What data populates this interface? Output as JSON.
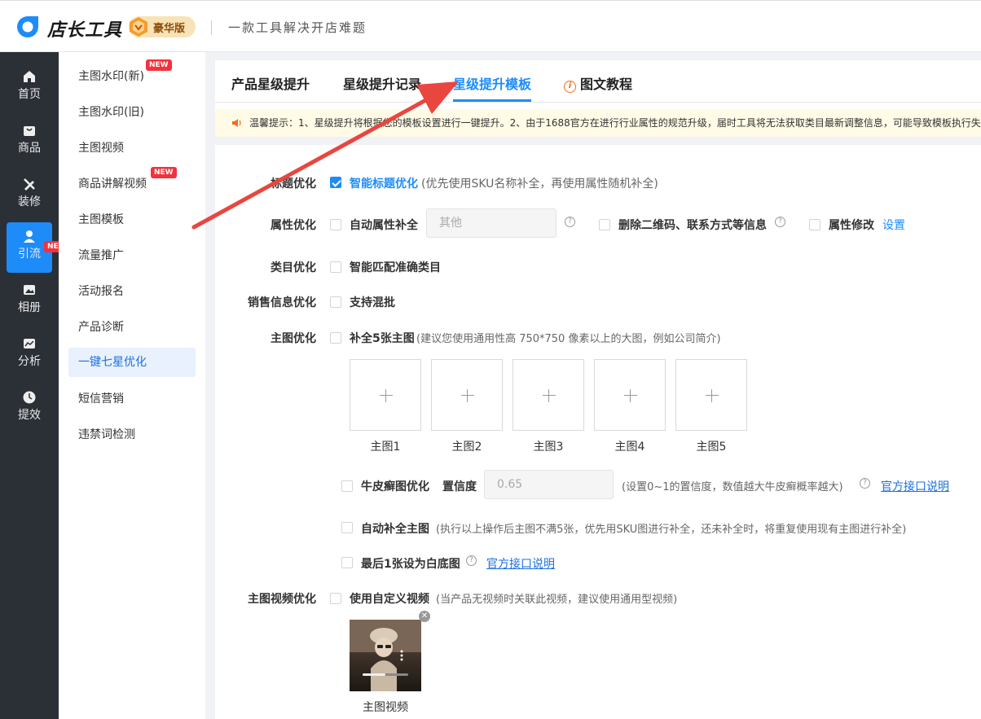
{
  "header": {
    "brand": "店长工具",
    "vip_label": "豪华版",
    "slogan": "一款工具解决开店难题"
  },
  "leftnav": {
    "items": [
      {
        "label": "首页",
        "icon": "home-icon"
      },
      {
        "label": "商品",
        "icon": "bag-icon"
      },
      {
        "label": "装修",
        "icon": "brush-icon"
      },
      {
        "label": "引流",
        "icon": "user-icon",
        "active": true,
        "badge": "NEW"
      },
      {
        "label": "相册",
        "icon": "image-icon"
      },
      {
        "label": "分析",
        "icon": "chart-icon"
      },
      {
        "label": "提效",
        "icon": "clock-icon"
      }
    ]
  },
  "subnav": {
    "items": [
      {
        "label": "主图水印(新)",
        "badge": "NEW"
      },
      {
        "label": "主图水印(旧)"
      },
      {
        "label": "主图视频"
      },
      {
        "label": "商品讲解视频",
        "badge": "NEW"
      },
      {
        "label": "主图模板"
      },
      {
        "label": "流量推广"
      },
      {
        "label": "活动报名"
      },
      {
        "label": "产品诊断"
      },
      {
        "label": "一键七星优化",
        "active": true
      },
      {
        "label": "短信营销"
      },
      {
        "label": "违禁词检测"
      }
    ]
  },
  "tabs": {
    "t1": "产品星级提升",
    "t2": "星级提升记录",
    "t3": "星级提升模板",
    "t4": "图文教程",
    "active": "星级提升模板"
  },
  "notice": "温馨提示：1、星级提升将根据您的模板设置进行一键提升。2、由于1688官方在进行行业属性的规范升级，届时工具将无法获取类目最新调整信息，可能导致模板执行失败",
  "form": {
    "title_opt": {
      "label": "标题优化",
      "option": "智能标题优化",
      "hint": "(优先使用SKU名称补全，再使用属性随机补全)",
      "checked": true
    },
    "attr_opt": {
      "label": "属性优化",
      "auto_fill": "自动属性补全",
      "input_placeholder": "其他",
      "remove_qr": "删除二维码、联系方式等信息",
      "modify": "属性修改",
      "settings_link": "设置"
    },
    "category_opt": {
      "label": "类目优化",
      "option": "智能匹配准确类目"
    },
    "sales_opt": {
      "label": "销售信息优化",
      "option": "支持混批"
    },
    "main_img_opt": {
      "label": "主图优化",
      "option": "补全5张主图",
      "hint": "(建议您使用通用性高 750*750 像素以上的大图，例如公司简介)",
      "slots": [
        "主图1",
        "主图2",
        "主图3",
        "主图4",
        "主图5"
      ],
      "psoriasis": {
        "option": "牛皮癣图优化",
        "confidence_label": "置信度",
        "confidence_value": "0.65",
        "hint": "(设置0~1的置信度，数值越大牛皮癣概率越大)",
        "link": "官方接口说明"
      },
      "auto_fill": {
        "option": "自动补全主图",
        "hint": "(执行以上操作后主图不满5张，优先用SKU图进行补全，还未补全时，将重复使用现有主图进行补全)"
      },
      "white_bg": {
        "option": "最后1张设为白底图",
        "link": "官方接口说明"
      }
    },
    "video_opt": {
      "label": "主图视频优化",
      "option": "使用自定义视频",
      "hint": "(当产品无视频时关联此视频，建议使用通用型视频)",
      "video_caption": "主图视频"
    }
  },
  "colors": {
    "accent": "#1d8cf8",
    "arrow": "#e8463f",
    "nav_bg": "#2b2f36"
  }
}
